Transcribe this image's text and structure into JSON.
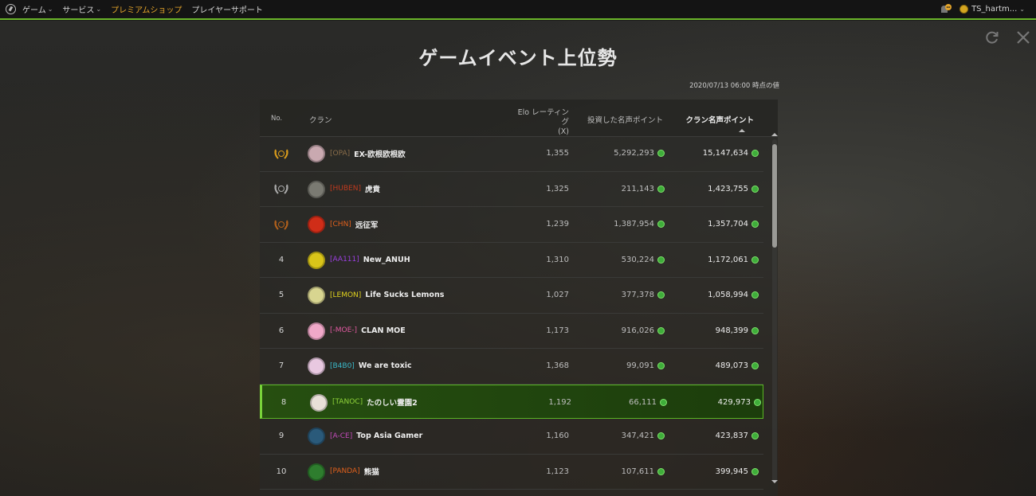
{
  "nav": {
    "items": [
      {
        "label": "ゲーム",
        "has_menu": true
      },
      {
        "label": "サービス",
        "has_menu": true
      },
      {
        "label": "プレミアムショップ",
        "has_menu": false
      },
      {
        "label": "プレイヤーサポート",
        "has_menu": false
      }
    ],
    "username": "TS_hartm..."
  },
  "page": {
    "title": "ゲームイベント上位勢",
    "as_of": "2020/07/13 06:00 時点の値"
  },
  "table": {
    "headers": {
      "no": "No.",
      "clan": "クラン",
      "elo_line1": "Elo レーティング",
      "elo_line2": "(X)",
      "invested": "投資した名声ポイント",
      "clan_points": "クラン名声ポイント"
    },
    "rows": [
      {
        "rank": "1",
        "rank_icon": "gold-laurel",
        "emblem_color": "#c9a9b0",
        "tag": "[OPA]",
        "tag_color": "#8a6e4a",
        "name": "EX-欧根欧根欧",
        "elo": "1,355",
        "invested": "5,292,293",
        "points": "15,147,634"
      },
      {
        "rank": "2",
        "rank_icon": "silver-laurel",
        "emblem_color": "#7a7a72",
        "tag": "[HUBEN]",
        "tag_color": "#c03a1e",
        "name": "虎賁",
        "elo": "1,325",
        "invested": "211,143",
        "points": "1,423,755"
      },
      {
        "rank": "3",
        "rank_icon": "bronze-laurel",
        "emblem_color": "#d02d18",
        "tag": "[CHN]",
        "tag_color": "#e0601c",
        "name": "远征军",
        "elo": "1,239",
        "invested": "1,387,954",
        "points": "1,357,704"
      },
      {
        "rank": "4",
        "rank_icon": "",
        "emblem_color": "#d9c419",
        "tag": "[AA111]",
        "tag_color": "#9b3fe0",
        "name": "New_ANUH",
        "elo": "1,310",
        "invested": "530,224",
        "points": "1,172,061"
      },
      {
        "rank": "5",
        "rank_icon": "",
        "emblem_color": "#d8d590",
        "tag": "[LEMON]",
        "tag_color": "#e0d21e",
        "name": "Life Sucks Lemons",
        "elo": "1,027",
        "invested": "377,378",
        "points": "1,058,994"
      },
      {
        "rank": "6",
        "rank_icon": "",
        "emblem_color": "#f0a8c8",
        "tag": "[-MOE-]",
        "tag_color": "#e05aa0",
        "name": "CLAN MOE",
        "elo": "1,173",
        "invested": "916,026",
        "points": "948,399"
      },
      {
        "rank": "7",
        "rank_icon": "",
        "emblem_color": "#e8c8e0",
        "tag": "[B4B0]",
        "tag_color": "#3ab8c8",
        "name": "We are toxic",
        "elo": "1,368",
        "invested": "99,091",
        "points": "489,073"
      },
      {
        "rank": "8",
        "rank_icon": "",
        "emblem_color": "#e8e0d8",
        "tag": "[TANOC]",
        "tag_color": "#8fd33a",
        "name": "たのしい霊園2",
        "elo": "1,192",
        "invested": "66,111",
        "points": "429,973",
        "highlight": true
      },
      {
        "rank": "9",
        "rank_icon": "",
        "emblem_color": "#2a5a7a",
        "tag": "[A-CE]",
        "tag_color": "#c04ab8",
        "name": "Top Asia Gamer",
        "elo": "1,160",
        "invested": "347,421",
        "points": "423,837"
      },
      {
        "rank": "10",
        "rank_icon": "",
        "emblem_color": "#2e7d2e",
        "tag": "[PANDA]",
        "tag_color": "#e0601c",
        "name": "熊猫",
        "elo": "1,123",
        "invested": "107,611",
        "points": "399,945"
      }
    ]
  },
  "colors": {
    "accent": "#6bb52a",
    "premium": "#e5a52a",
    "gem": "#3fae3a"
  }
}
